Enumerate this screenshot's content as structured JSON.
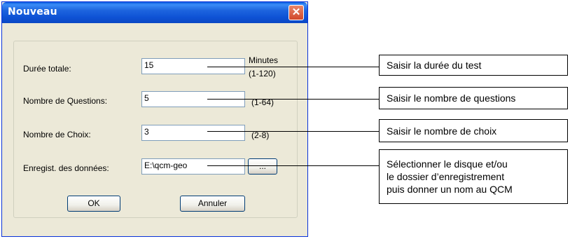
{
  "dialog": {
    "title": "Nouveau",
    "close_symbol": "✕",
    "fields": [
      {
        "label": "Durée totale:",
        "value": "15",
        "unit_top": "Minutes",
        "unit_bottom": "(1-120)"
      },
      {
        "label": "Nombre de Questions:",
        "value": "5",
        "unit": "(1-64)"
      },
      {
        "label": "Nombre de Choix:",
        "value": "3",
        "unit": "(2-8)"
      },
      {
        "label": "Enregist. des données:",
        "value": "E:\\qcm-geo",
        "browse_label": "..."
      }
    ],
    "ok_label": "OK",
    "cancel_label": "Annuler"
  },
  "callouts": {
    "duration": "Saisir la durée du test",
    "questions": "Saisir le nombre de questions",
    "choices": "Saisir le nombre de choix",
    "folder": "Sélectionner le disque et/ou\nle dossier d’enregistrement\npuis donner un nom au QCM"
  }
}
